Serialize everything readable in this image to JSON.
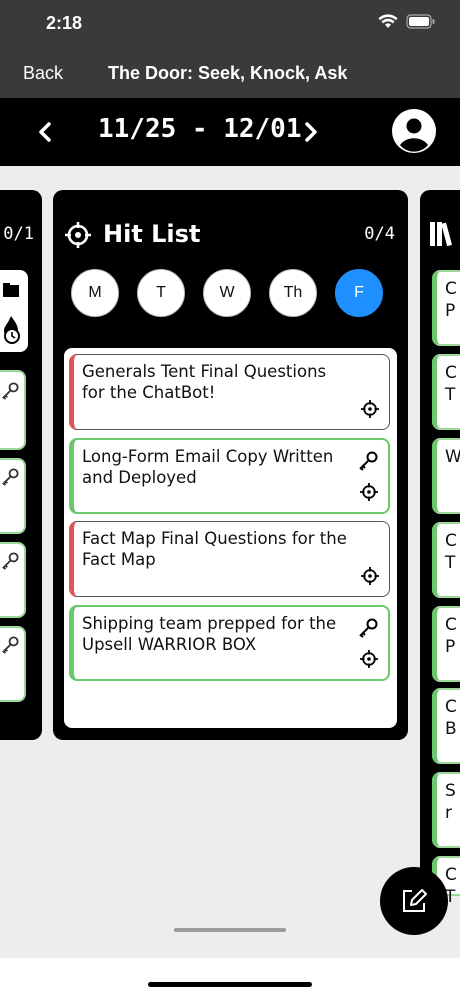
{
  "status": {
    "time": "2:18"
  },
  "nav": {
    "back_label": "Back",
    "title": "The Door: Seek, Knock, Ask"
  },
  "week": {
    "prev_icon": "chevron-left",
    "range": "11/25 - 12/01",
    "next_icon": "chevron-right",
    "profile_icon": "user-avatar"
  },
  "left_column": {
    "count": "0/1"
  },
  "main_column": {
    "title": "Hit List",
    "count": "0/4",
    "days": [
      "M",
      "T",
      "W",
      "Th",
      "F"
    ],
    "selected_day": "F",
    "cards": [
      {
        "text": "Generals Tent Final Questions for the ChatBot!",
        "has_key": false,
        "status": "open"
      },
      {
        "text": "Long-Form Email Copy Written and Deployed",
        "has_key": true,
        "status": "done"
      },
      {
        "text": "Fact Map Final Questions for the Fact Map",
        "has_key": false,
        "status": "open"
      },
      {
        "text": "Shipping team prepped for the Upsell WARRIOR BOX",
        "has_key": true,
        "status": "done"
      }
    ]
  },
  "right_column": {
    "items": [
      "C P",
      "C T",
      "W",
      "C T",
      "C P",
      "C B",
      "S r",
      "C T"
    ]
  },
  "colors": {
    "accent": "#1e90ff",
    "open_bar": "#e05555",
    "done_bar": "#6cc86c",
    "bar_bg": "#3a3a3a"
  }
}
